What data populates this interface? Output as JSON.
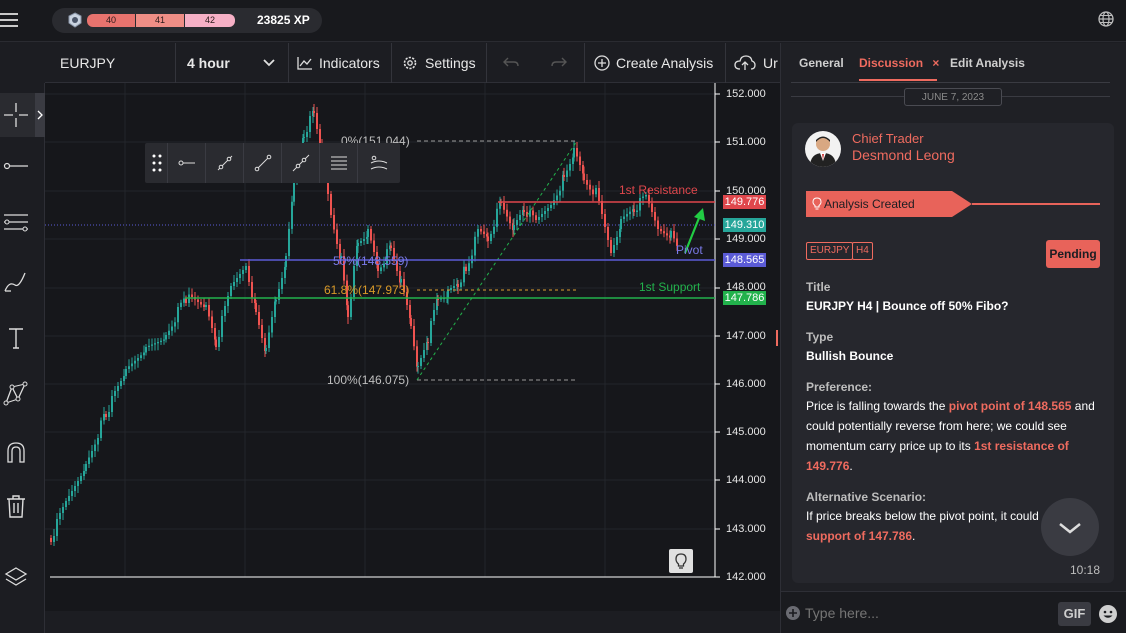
{
  "topbar": {
    "levels": [
      "40",
      "41",
      "42"
    ],
    "xp": "23825 XP"
  },
  "toolbar": {
    "symbol": "EURJPY",
    "timeframe": "4 hour",
    "indicators": "Indicators",
    "settings": "Settings",
    "create_analysis": "Create Analysis",
    "upload": "Ur"
  },
  "chart": {
    "price_axis": [
      "152.000",
      "151.000",
      "150.000",
      "149.000",
      "148.000",
      "147.000",
      "146.000",
      "145.000",
      "144.000",
      "143.000",
      "142.000"
    ],
    "fib_0": "0%(151.044)",
    "fib_50": "50%(148.559)",
    "fib_618": "61.8%(147.973)",
    "fib_100": "100%(146.075)",
    "resistance_label": "1st Resistance",
    "support_label": "1st Support",
    "pivot_label": "Pivot",
    "tag_resistance": "149.776",
    "tag_current": "149.310",
    "tag_pivot": "148.565",
    "tag_support": "147.786",
    "colors": {
      "resistance": "#e0474c",
      "current": "#26a69a",
      "pivot": "#5b5bd6",
      "support": "#22b24c",
      "up_candle": "#26a69a",
      "down_candle": "#ef5350"
    }
  },
  "panel": {
    "tabs": [
      "General",
      "Discussion",
      "Edit Analysis"
    ],
    "date": "JUNE 7, 2023",
    "author_role": "Chief Trader",
    "author_name": "Desmond Leong",
    "banner": "Analysis Created",
    "tags": [
      "EURJPY",
      "H4"
    ],
    "status": "Pending",
    "title_label": "Title",
    "title_value": "EURJPY H4 | Bounce off 50% Fibo?",
    "type_label": "Type",
    "type_value": "Bullish Bounce",
    "pref_label": "Preference:",
    "pref_text_1": "Price is falling towards the ",
    "pref_hl_1": "pivot point of 148.565",
    "pref_text_2": " and could potentially reverse from here; we could see momentum carry price up to its ",
    "pref_hl_2": "1st resistance of 149.776",
    "pref_text_3": ".",
    "alt_label": "Alternative Scenario:",
    "alt_text_1": "If price breaks below the pivot point, it could",
    "alt_hl_1": "support of 147.786",
    "alt_text_2": ".",
    "time": "10:18",
    "chat_placeholder": "Type here...",
    "gif": "GIF"
  }
}
